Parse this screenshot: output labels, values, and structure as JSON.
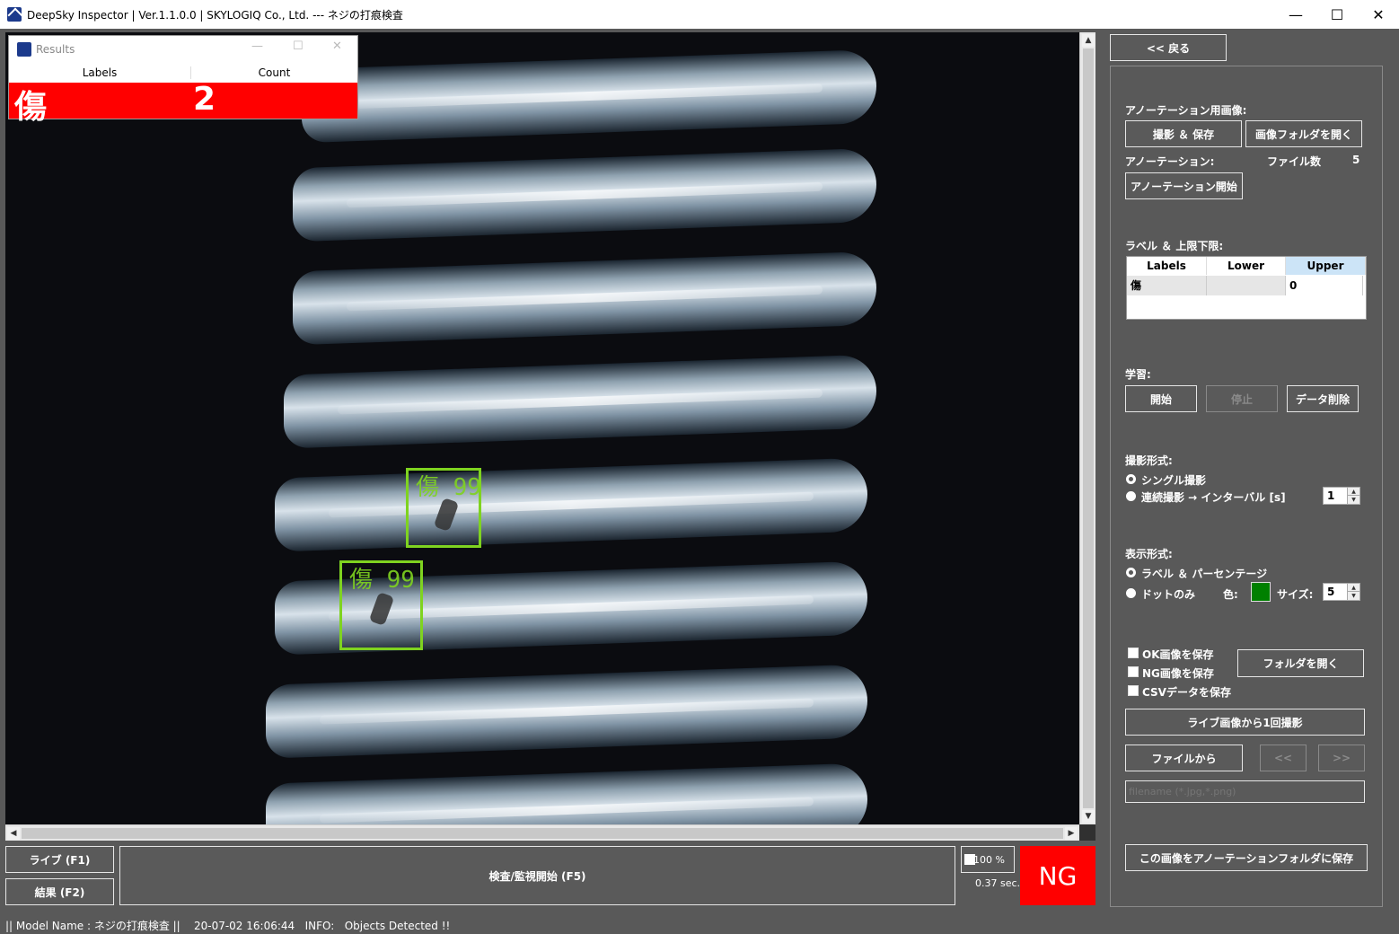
{
  "window": {
    "title": "DeepSky Inspector | Ver.1.1.0.0 | SKYLOGIQ Co., Ltd. --- ネジの打痕検査",
    "minimize": "—",
    "maximize": "☐",
    "close": "✕"
  },
  "results": {
    "title": "Results",
    "col_labels": "Labels",
    "col_count": "Count",
    "row_label": "傷",
    "row_count": "2"
  },
  "detections": [
    {
      "label": "傷  99"
    },
    {
      "label": "傷  99"
    }
  ],
  "scroll": {
    "up": "▲",
    "down": "▼",
    "left": "◀",
    "right": "▶"
  },
  "panel": {
    "back_button": "<< 戻る",
    "annotation_image_label": "アノーテーション用画像:",
    "capture_save_button": "撮影 ＆ 保存",
    "open_image_folder_button": "画像フォルダを開く",
    "annotation_label": "アノーテーション:",
    "file_count_label": "ファイル数",
    "file_count_value": "5",
    "annotation_start_button": "アノーテーション開始",
    "label_limits_label": "ラベル ＆ 上限下限:",
    "grid_headers": [
      "Labels",
      "Lower",
      "Upper"
    ],
    "grid_row": [
      "傷",
      "",
      "0"
    ],
    "learning_label": "学習:",
    "learn_start_button": "開始",
    "learn_stop_button": "停止",
    "delete_data_button": "データ削除",
    "capture_mode_label": "撮影形式:",
    "single_capture": "シングル撮影",
    "continuous_capture": "連続撮影 → インターバル [s]",
    "interval_value": "1",
    "display_mode_label": "表示形式:",
    "label_percentage": "ラベル ＆ パーセンテージ",
    "dots_only": "ドットのみ",
    "color_label": "色:",
    "color_value": "#008000",
    "size_label": "サイズ:",
    "size_value": "5",
    "save_ok_images": "OK画像を保存",
    "save_ng_images": "NG画像を保存",
    "save_csv": "CSVデータを保存",
    "open_folder_button": "フォルダを開く",
    "capture_once_button": "ライブ画像から1回撮影",
    "from_file_button": "ファイルから",
    "prev_button": "<<",
    "next_button": ">>",
    "filename_placeholder": "filename (*.jpg,*.png)",
    "save_to_annotation_button": "この画像をアノーテーションフォルダに保存"
  },
  "bottom": {
    "live_button": "ライブ (F1)",
    "result_button": "結果 (F2)",
    "inspect_button": "検査/監視開始 (F5)",
    "zoom_label": "100 %",
    "time_label": "0.37 sec.",
    "result_indicator": "NG",
    "result_color": "#ff0000"
  },
  "status": {
    "text": "|| Model Name : ネジの打痕検査 ||    20-07-02 16:06:44   INFO:   Objects Detected !!"
  },
  "colors": {
    "background": "#595959",
    "bbox": "#7fd320",
    "ng": "#ff0000"
  }
}
